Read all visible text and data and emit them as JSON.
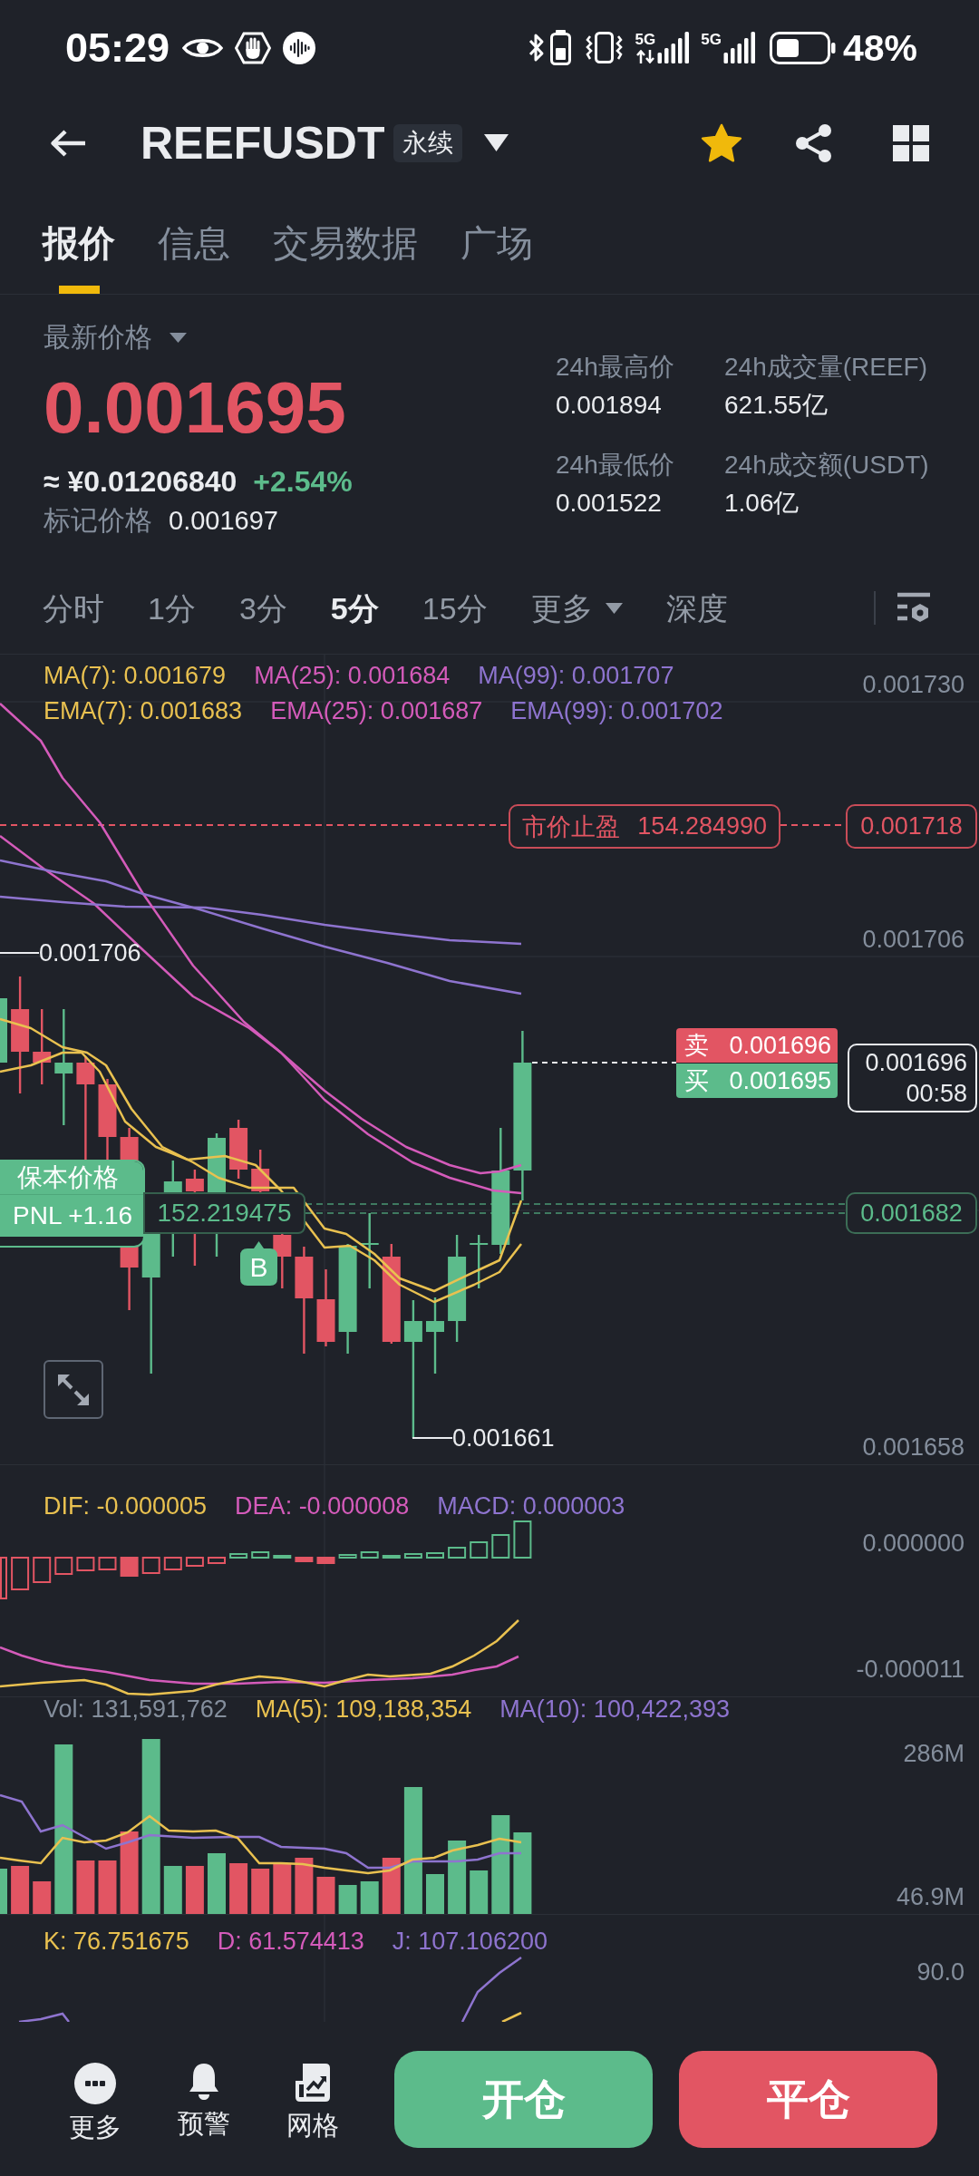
{
  "status_bar": {
    "time": "05:29",
    "signals": [
      {
        "label": "5G"
      },
      {
        "label": "5G"
      }
    ],
    "battery": "48%"
  },
  "header": {
    "title": "REEFUSDT",
    "tag": "永续",
    "favorite": true
  },
  "tabs": [
    {
      "label": "报价",
      "selected": true
    },
    {
      "label": "信息",
      "selected": false
    },
    {
      "label": "交易数据",
      "selected": false
    },
    {
      "label": "广场",
      "selected": false
    }
  ],
  "price": {
    "label": "最新价格",
    "last": "0.001695",
    "fiat": "≈ ¥0.01206840",
    "change": "+2.54%",
    "mark_label": "标记价格",
    "mark": "0.001697"
  },
  "stats": [
    {
      "label": "24h最高价",
      "value": "0.001894"
    },
    {
      "label": "24h成交量(REEF)",
      "value": "621.55亿"
    },
    {
      "label": "24h最低价",
      "value": "0.001522"
    },
    {
      "label": "24h成交额(USDT)",
      "value": "1.06亿"
    }
  ],
  "intervals": [
    {
      "label": "分时",
      "kind": "interval",
      "selected": false
    },
    {
      "label": "1分",
      "kind": "interval",
      "selected": false
    },
    {
      "label": "3分",
      "kind": "interval",
      "selected": false
    },
    {
      "label": "5分",
      "kind": "interval",
      "selected": true
    },
    {
      "label": "15分",
      "kind": "interval",
      "selected": false
    },
    {
      "label": "更多",
      "kind": "menu",
      "selected": false
    },
    {
      "label": "深度",
      "kind": "interval",
      "selected": false
    }
  ],
  "chart": {
    "ma_legend": [
      {
        "text": "MA(7): 0.001679",
        "color": "#e9c150"
      },
      {
        "text": "MA(25): 0.001684",
        "color": "#d45bba"
      },
      {
        "text": "MA(99): 0.001707",
        "color": "#8e74cf"
      }
    ],
    "ema_legend": [
      {
        "text": "EMA(7): 0.001683",
        "color": "#e9c150"
      },
      {
        "text": "EMA(25): 0.001687",
        "color": "#d45bba"
      },
      {
        "text": "EMA(99): 0.001702",
        "color": "#8e74cf"
      }
    ],
    "price_axis": [
      "0.001730",
      "0.001706",
      "0.001658"
    ],
    "high_label": "0.001706",
    "low_label": "0.001661",
    "take_profit": {
      "label": "市价止盈",
      "amount": "154.284990",
      "price": "0.001718"
    },
    "ask": {
      "label": "卖",
      "price": "0.001696"
    },
    "bid": {
      "label": "买",
      "price": "0.001695"
    },
    "last_price": {
      "price": "0.001696",
      "countdown": "00:58"
    },
    "position": {
      "label": "保本价格",
      "pnl": "PNL +1.16",
      "amount": "152.219475",
      "price": "0.001682"
    },
    "trade_marker": "B"
  },
  "macd": {
    "legend": [
      {
        "text": "DIF: -0.000005",
        "color": "#e9c150"
      },
      {
        "text": "DEA: -0.000008",
        "color": "#d45bba"
      },
      {
        "text": "MACD: 0.000003",
        "color": "#8e74cf"
      }
    ],
    "axis": [
      "0.000000",
      "-0.000011"
    ]
  },
  "volume": {
    "legend": [
      {
        "text": "Vol: 131,591,762",
        "color": "#848e9c"
      },
      {
        "text": "MA(5): 109,188,354",
        "color": "#e9c150"
      },
      {
        "text": "MA(10): 100,422,393",
        "color": "#8e74cf"
      }
    ],
    "axis": [
      "286M",
      "46.9M"
    ]
  },
  "kdj": {
    "legend": [
      {
        "text": "K: 76.751675",
        "color": "#e9c150"
      },
      {
        "text": "D: 61.574413",
        "color": "#d45bba"
      },
      {
        "text": "J: 107.106200",
        "color": "#8e74cf"
      }
    ],
    "axis": [
      "90.0"
    ]
  },
  "bottom_bar": {
    "tools": [
      {
        "label": "更多",
        "kind": "more"
      },
      {
        "label": "预警",
        "kind": "alert"
      },
      {
        "label": "网格",
        "kind": "grid"
      }
    ],
    "buttons": [
      {
        "label": "开仓",
        "kind": "open"
      },
      {
        "label": "平仓",
        "kind": "close"
      }
    ]
  }
}
